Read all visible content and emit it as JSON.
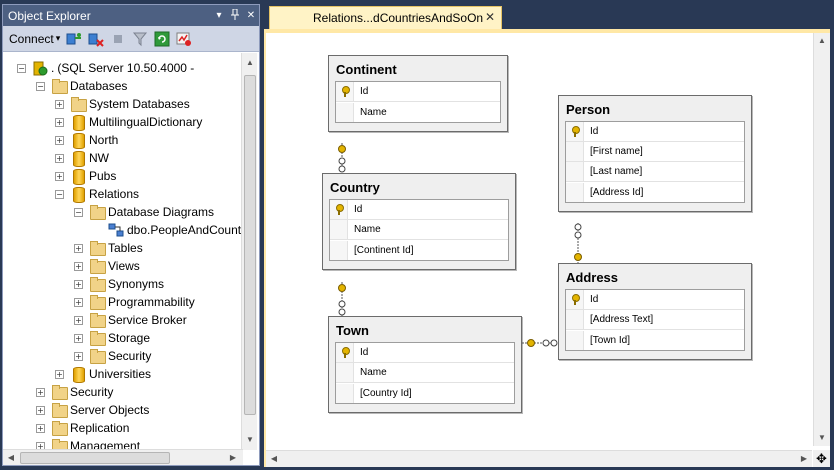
{
  "object_explorer": {
    "title": "Object Explorer",
    "toolbar": {
      "connect_label": "Connect",
      "connect_arrow": "▾"
    },
    "tree": [
      {
        "label": "(SQL Server 10.50.4000 -",
        "prefix": ".",
        "expander": "⊟",
        "icon": "server-icon"
      },
      {
        "label": "Databases",
        "expander": "⊟",
        "icon": "folder-icon"
      },
      {
        "label": "System Databases",
        "expander": "⊞",
        "icon": "folder-icon"
      },
      {
        "label": "MultilingualDictionary",
        "expander": "⊞",
        "icon": "database-icon"
      },
      {
        "label": "North",
        "expander": "⊞",
        "icon": "database-icon"
      },
      {
        "label": "NW",
        "expander": "⊞",
        "icon": "database-icon"
      },
      {
        "label": "Pubs",
        "expander": "⊞",
        "icon": "database-icon"
      },
      {
        "label": "Relations",
        "expander": "⊟",
        "icon": "database-icon"
      },
      {
        "label": "Database Diagrams",
        "expander": "⊟",
        "icon": "folder-icon"
      },
      {
        "label": "dbo.PeopleAndCount",
        "expander": "",
        "icon": "diagram-icon"
      },
      {
        "label": "Tables",
        "expander": "⊞",
        "icon": "folder-icon"
      },
      {
        "label": "Views",
        "expander": "⊞",
        "icon": "folder-icon"
      },
      {
        "label": "Synonyms",
        "expander": "⊞",
        "icon": "folder-icon"
      },
      {
        "label": "Programmability",
        "expander": "⊞",
        "icon": "folder-icon"
      },
      {
        "label": "Service Broker",
        "expander": "⊞",
        "icon": "folder-icon"
      },
      {
        "label": "Storage",
        "expander": "⊞",
        "icon": "folder-icon"
      },
      {
        "label": "Security",
        "expander": "⊞",
        "icon": "folder-icon"
      },
      {
        "label": "Universities",
        "expander": "⊞",
        "icon": "database-icon"
      },
      {
        "label": "Security",
        "expander": "⊞",
        "icon": "folder-icon"
      },
      {
        "label": "Server Objects",
        "expander": "⊞",
        "icon": "folder-icon"
      },
      {
        "label": "Replication",
        "expander": "⊞",
        "icon": "folder-icon"
      },
      {
        "label": "Management",
        "expander": "⊞",
        "icon": "folder-icon"
      }
    ]
  },
  "document": {
    "tab_label": "Relations...dCountriesAndSoOn",
    "tab_close": "✕",
    "tables": [
      {
        "name": "Continent",
        "columns": [
          {
            "name": "Id",
            "key": true
          },
          {
            "name": "Name",
            "key": false
          }
        ]
      },
      {
        "name": "Country",
        "columns": [
          {
            "name": "Id",
            "key": true
          },
          {
            "name": "Name",
            "key": false
          },
          {
            "name": "[Continent Id]",
            "key": false
          }
        ]
      },
      {
        "name": "Town",
        "columns": [
          {
            "name": "Id",
            "key": true
          },
          {
            "name": "Name",
            "key": false
          },
          {
            "name": "[Country Id]",
            "key": false
          }
        ]
      },
      {
        "name": "Person",
        "columns": [
          {
            "name": "Id",
            "key": true
          },
          {
            "name": "[First name]",
            "key": false
          },
          {
            "name": "[Last name]",
            "key": false
          },
          {
            "name": "[Address Id]",
            "key": false
          }
        ]
      },
      {
        "name": "Address",
        "columns": [
          {
            "name": "Id",
            "key": true
          },
          {
            "name": "[Address Text]",
            "key": false
          },
          {
            "name": "[Town Id]",
            "key": false
          }
        ]
      }
    ]
  },
  "colors": {
    "chrome": "#293955",
    "tab_active": "#fff3c6",
    "key_gold": "#e3b400"
  }
}
